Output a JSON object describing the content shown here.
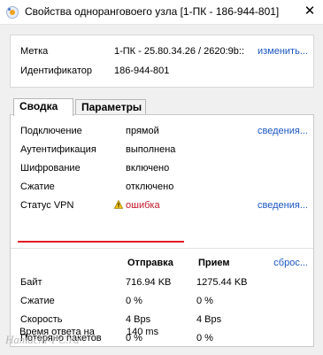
{
  "window": {
    "title": "Свойства одноранговоего узла [1-ПК - 186-944-801]",
    "close": "✕"
  },
  "identity": {
    "label_label": "Метка",
    "label_value": "1-ПК - 25.80.34.26 / 2620:9b::",
    "change_link": "изменить...",
    "id_label": "Идентификатор",
    "id_value": "186-944-801"
  },
  "tabs": [
    {
      "label": "Сводка",
      "active": true
    },
    {
      "label": "Параметры",
      "active": false
    }
  ],
  "summary": {
    "connection_label": "Подключение",
    "connection_value": "прямой",
    "details_link_1": "сведения...",
    "auth_label": "Аутентификация",
    "auth_value": "выполнена",
    "encryption_label": "Шифрование",
    "encryption_value": "включено",
    "compression_label": "Сжатие",
    "compression_value": "отключено",
    "vpn_label": "Статус VPN",
    "vpn_value": "ошибка",
    "vpn_icon": "warning-icon",
    "details_link_2": "сведения..."
  },
  "stats": {
    "col_send": "Отправка",
    "col_recv": "Прием",
    "reset_link": "сброс...",
    "rows": [
      {
        "label": "Байт",
        "send": "716.94 KB",
        "recv": "1275.44 KB"
      },
      {
        "label": "Сжатие",
        "send": "0 %",
        "recv": "0 %"
      },
      {
        "label": "Скорость",
        "send": "4 Bps",
        "recv": "4 Bps"
      },
      {
        "label": "Потеряно пакетов",
        "send": "0 %",
        "recv": "0 %"
      }
    ],
    "rtt_label": "Время ответа на",
    "rtt_value": "140 ms"
  },
  "watermark": "Hamachi-PC.ru",
  "colors": {
    "link": "#1a56c2",
    "error": "#c2172a",
    "highlight_underline": "#e21a21"
  }
}
